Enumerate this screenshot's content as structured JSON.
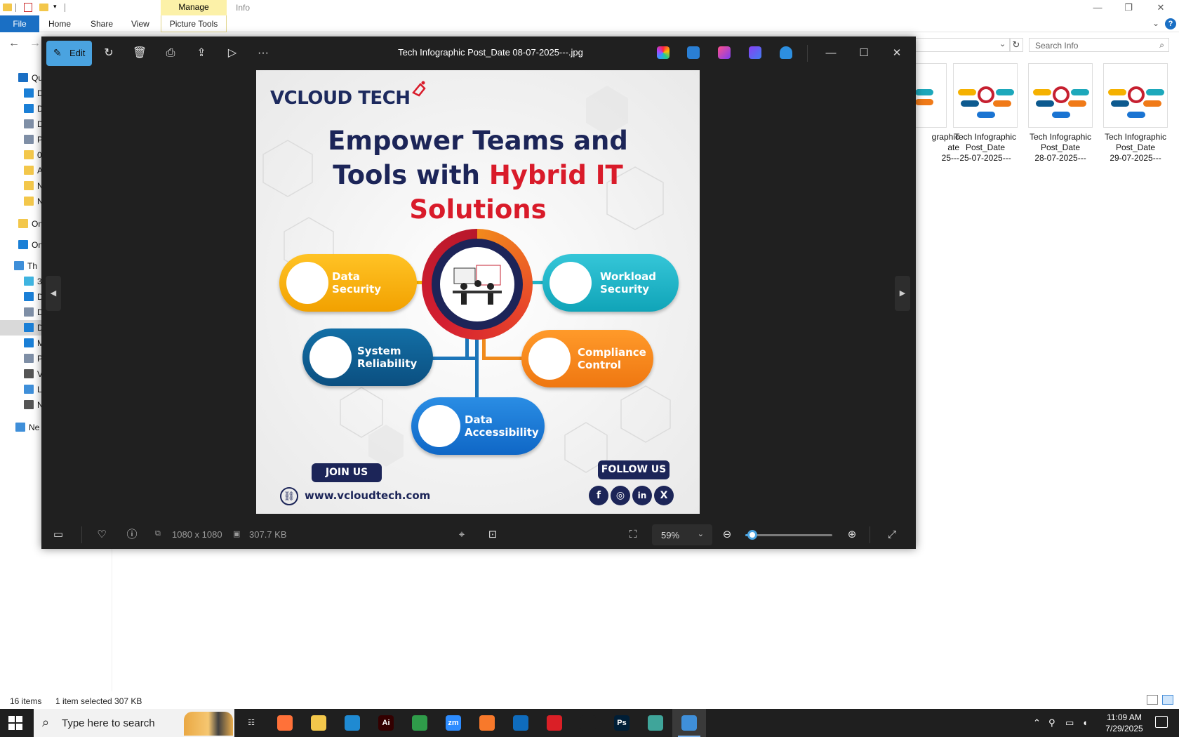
{
  "explorer": {
    "ribbon": {
      "manage": "Manage",
      "tabs": [
        "File",
        "Home",
        "Share",
        "View",
        "Picture Tools"
      ]
    },
    "window_title": "Info",
    "search_placeholder": "Search Info",
    "sidebar": [
      {
        "label": "Qu",
        "icon": "quick-access-icon",
        "color": "#1a6fc4"
      },
      {
        "label": "D",
        "icon": "desktop-icon",
        "color": "#1a7fd6"
      },
      {
        "label": "D",
        "icon": "downloads-icon",
        "color": "#1a7fd6"
      },
      {
        "label": "D",
        "icon": "documents-icon",
        "color": "#7f8fa6"
      },
      {
        "label": "P",
        "icon": "pictures-icon",
        "color": "#7f8fa6"
      },
      {
        "label": "0",
        "icon": "folder-icon",
        "color": "#f3c74b"
      },
      {
        "label": "A",
        "icon": "folder-icon",
        "color": "#f3c74b"
      },
      {
        "label": "N",
        "icon": "folder-icon",
        "color": "#f3c74b"
      },
      {
        "label": "N",
        "icon": "folder-icon",
        "color": "#f3c74b"
      },
      {
        "label": "On",
        "icon": "folder-icon",
        "color": "#f3c74b"
      },
      {
        "label": "On",
        "icon": "onedrive-icon",
        "color": "#1a7fd6"
      },
      {
        "label": "Th",
        "icon": "this-pc-icon",
        "color": "#3f8fd9"
      },
      {
        "label": "3",
        "icon": "3d-objects-icon",
        "color": "#3fb4e0"
      },
      {
        "label": "D",
        "icon": "desktop-icon",
        "color": "#1a7fd6"
      },
      {
        "label": "D",
        "icon": "documents-icon",
        "color": "#7f8fa6"
      },
      {
        "label": "D",
        "icon": "downloads-icon",
        "color": "#1a7fd6"
      },
      {
        "label": "M",
        "icon": "music-icon",
        "color": "#1a7fd6"
      },
      {
        "label": "P",
        "icon": "pictures-icon",
        "color": "#7f8fa6"
      },
      {
        "label": "V",
        "icon": "videos-icon",
        "color": "#555555"
      },
      {
        "label": "L",
        "icon": "local-disk-icon",
        "color": "#3f8fd9"
      },
      {
        "label": "N",
        "icon": "drive-icon",
        "color": "#555555"
      },
      {
        "label": "Ne",
        "icon": "network-icon",
        "color": "#3f8fd9"
      }
    ],
    "thumbnails": [
      {
        "line1": "graphic",
        "line2": "ate",
        "line3": "25---"
      },
      {
        "line1": "Tech Infographic",
        "line2": "Post_Date",
        "line3": "25-07-2025---"
      },
      {
        "line1": "Tech Infographic",
        "line2": "Post_Date",
        "line3": "28-07-2025---"
      },
      {
        "line1": "Tech Infographic",
        "line2": "Post_Date",
        "line3": "29-07-2025---"
      }
    ],
    "status": {
      "items": "16 items",
      "selected": "1 item selected  307 KB"
    }
  },
  "photos": {
    "edit_label": "Edit",
    "title": "Tech Infographic Post_Date 08-07-2025---.jpg",
    "dimensions": "1080 x 1080",
    "file_size": "307.7 KB",
    "zoom": "59%",
    "zoom_fraction": 0.08
  },
  "poster": {
    "logo": "VCLOUD TECH",
    "headline_1": "Empower Teams and",
    "headline_2a": "Tools with ",
    "headline_2b": "Hybrid IT",
    "headline_3": "Solutions",
    "pills": {
      "ds": [
        "Data",
        "Security"
      ],
      "ws": [
        "Workload",
        "Security"
      ],
      "sr": [
        "System",
        "Reliability"
      ],
      "cc": [
        "Compliance",
        "Control"
      ],
      "da": [
        "Data",
        "Accessibility"
      ]
    },
    "join": "JOIN US",
    "follow": "FOLLOW US",
    "site": "www.vcloudtech.com",
    "social": [
      "f",
      "◎",
      "in",
      "X"
    ]
  },
  "taskbar": {
    "search_placeholder": "Type here to search",
    "time": "11:09 AM",
    "date": "7/29/2025",
    "apps": [
      {
        "name": "task-view",
        "label": "☷",
        "color": "#1f1f1f"
      },
      {
        "name": "firefox",
        "label": "",
        "color": "#ff7139"
      },
      {
        "name": "file-explorer",
        "label": "",
        "color": "#f3c74b"
      },
      {
        "name": "vscode",
        "label": "",
        "color": "#1f8ad2"
      },
      {
        "name": "illustrator",
        "label": "Ai",
        "color": "#330000"
      },
      {
        "name": "chrome",
        "label": "",
        "color": "#2f9c4a"
      },
      {
        "name": "zoom",
        "label": "zm",
        "color": "#2d8cff"
      },
      {
        "name": "xampp",
        "label": "",
        "color": "#f8792b"
      },
      {
        "name": "outlook",
        "label": "",
        "color": "#0f6cbd"
      },
      {
        "name": "creative-cloud",
        "label": "",
        "color": "#da1f26"
      },
      {
        "name": "pen-tool",
        "label": "",
        "color": "#1f1f1f"
      },
      {
        "name": "photoshop",
        "label": "Ps",
        "color": "#001e36"
      },
      {
        "name": "app-gem",
        "label": "",
        "color": "#3fa59a"
      },
      {
        "name": "photos",
        "label": "",
        "color": "#3f8fd9"
      }
    ]
  }
}
